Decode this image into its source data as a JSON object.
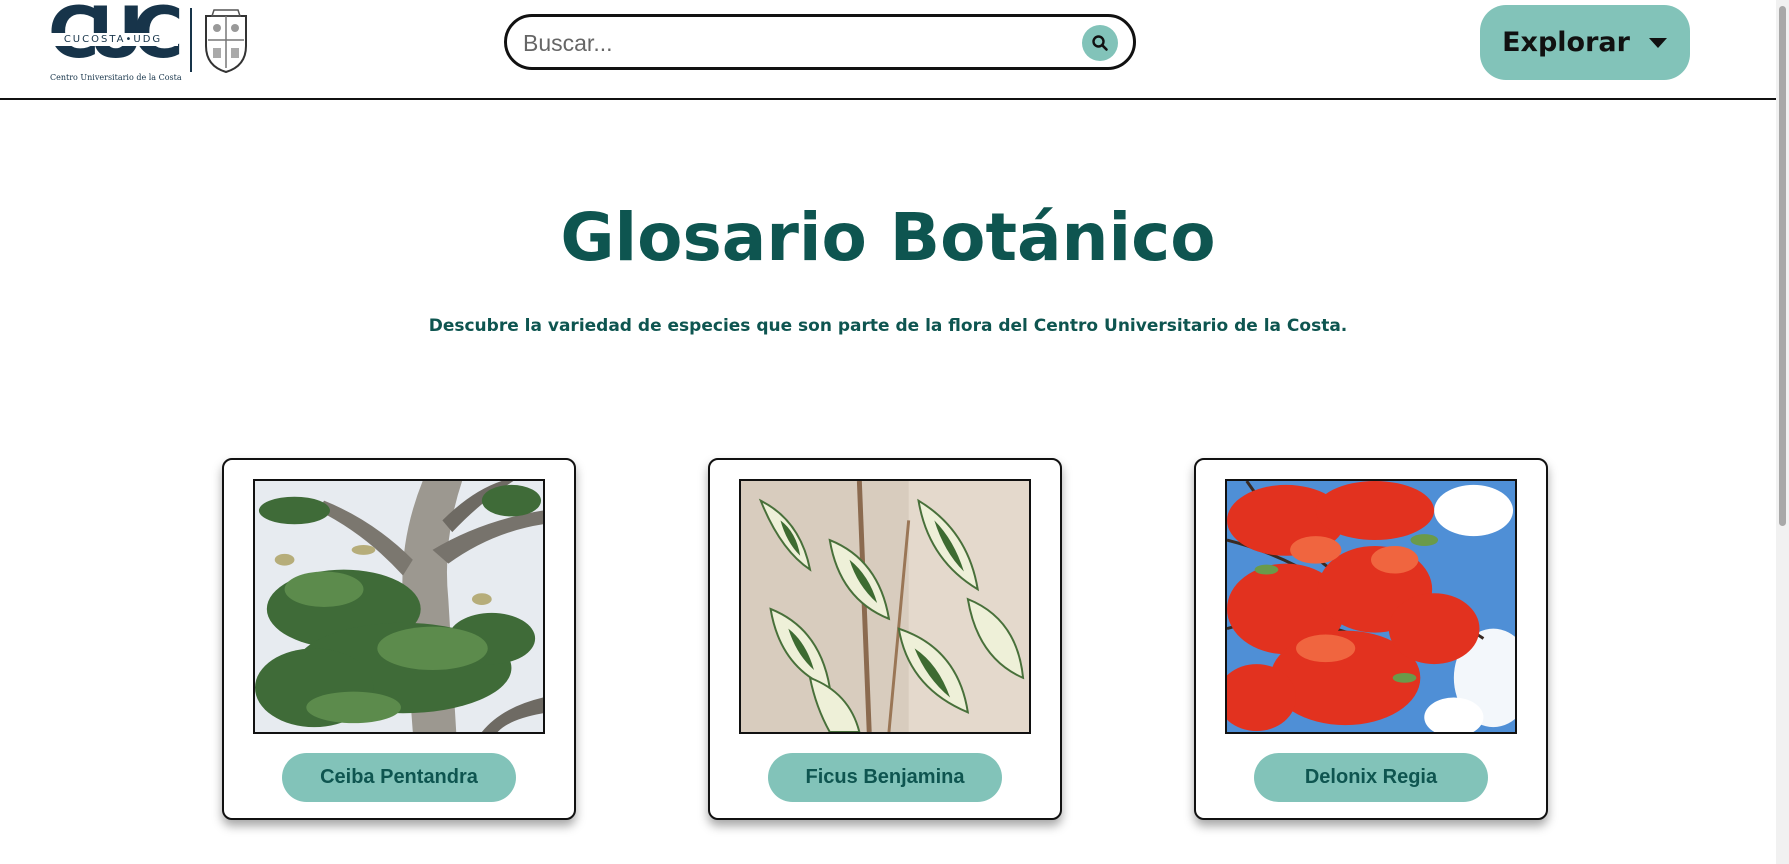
{
  "header": {
    "logo": {
      "mark_text": "CUC",
      "strip_text": "CUCOSTA•UDG",
      "subtitle": "Centro Universitario de la Costa"
    },
    "search": {
      "placeholder": "Buscar...",
      "value": "",
      "icon": "search-icon"
    },
    "explore": {
      "label": "Explorar",
      "icon": "caret-down-icon"
    }
  },
  "hero": {
    "title": "Glosario Botánico",
    "subtitle": "Descubre la variedad de especies que son parte de la flora del Centro Universitario de la Costa."
  },
  "cards": [
    {
      "label": "Ceiba Pentandra"
    },
    {
      "label": "Ficus Benjamina"
    },
    {
      "label": "Delonix Regia"
    }
  ],
  "colors": {
    "accent": "#82c3b9",
    "title": "#0e5550",
    "logo": "#17344a"
  }
}
